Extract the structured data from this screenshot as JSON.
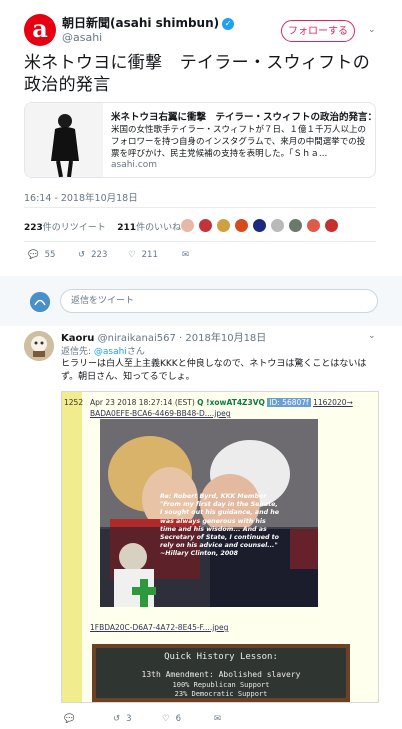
{
  "tweet": {
    "avatar_letter": "a",
    "author_name": "朝日新聞(asahi shimbun)",
    "author_handle": "@asahi",
    "follow_label": "フォローする",
    "headline": "米ネトウヨに衝撃　テイラー・スウィフトの政治的発言",
    "card": {
      "title": "米ネトウヨ右翼に衝撃　テイラー・スウィフトの政治的発言：朝…",
      "description": "米国の女性歌手テイラー・スウィフトが７日、１億１千万人以上のフォロワーを持つ自身のインスタグラムで、来月の中間選挙での投票を呼びかけ、民主党候補の支持を表明した。「Ｓｈａ…",
      "domain": "asahi.com"
    },
    "timestamp": "16:14 - 2018年10月18日",
    "retweets_count": "223",
    "retweets_label": "件のリツイート",
    "likes_count": "211",
    "likes_label": "件のいいね",
    "actions": {
      "replies": "55",
      "retweets": "223",
      "likes": "211"
    }
  },
  "reply_box": {
    "placeholder": "返信をツイート"
  },
  "reply": {
    "author_name": "Kaoru",
    "author_handle": "@niraikanai567",
    "date": "2018年10月18日",
    "reply_to_prefix": "返信先: ",
    "reply_to_handle": "@asahi",
    "reply_to_suffix": "さん",
    "text": "ヒラリーは白人至上主義KKKと仲良しなので、ネトウヨは驚くことはないはず。朝日さん、知ってるでしょ。",
    "quote": {
      "post_number": "1252",
      "meta_line": "Apr 23 2018 18:27:14 (EST)",
      "meta_id_label": "Q !xowAT4Z3VQ",
      "meta_id": "ID: 56807f",
      "meta_post": "1162020→",
      "file1": "BADA0EFE-BCA6-4469-BB48-D....jpeg",
      "caption": "Re: Robert Byrd, KKK Member \"From my first day in the Senate, I sought out his guidance, and he was always generous with his time and his wisdom... And as Secretary of State, I continued to rely on his advice and counsel...\" ~Hillary Clinton, 2008",
      "file2": "1FBDA20C-D6A7-4A72-8E45-F....jpeg",
      "chalk_title": "Quick History Lesson:",
      "chalk_line1": "13th Amendment: Abolished slavery",
      "chalk_line2": "100% Republican Support",
      "chalk_line3": "23% Democratic Support"
    },
    "actions": {
      "retweets": "3",
      "likes": "6"
    }
  },
  "colors": {
    "brand": "#e60012",
    "twitter_blue": "#1da1f2",
    "follow": "#e0245e"
  }
}
